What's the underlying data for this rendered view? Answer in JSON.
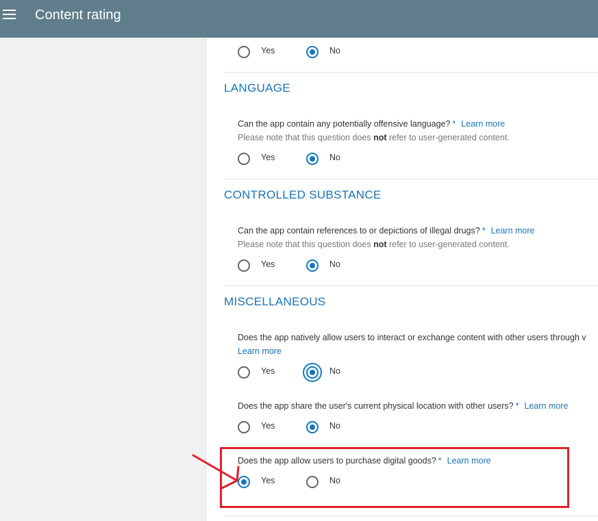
{
  "header": {
    "title": "Content rating"
  },
  "top_partial": {
    "yes_label": "Yes",
    "no_label": "No",
    "selected": "No"
  },
  "sections": [
    {
      "title": "LANGUAGE",
      "question": "Can the app contain any potentially offensive language?",
      "required": "*",
      "learn_more": "Learn more",
      "note_pre": "Please note that this question does ",
      "note_bold": "not",
      "note_post": " refer to user-generated content.",
      "yes_label": "Yes",
      "no_label": "No",
      "selected": "No"
    },
    {
      "title": "CONTROLLED SUBSTANCE",
      "question": "Can the app contain references to or depictions of illegal drugs?",
      "required": "*",
      "learn_more": "Learn more",
      "note_pre": "Please note that this question does ",
      "note_bold": "not",
      "note_post": " refer to user-generated content.",
      "yes_label": "Yes",
      "no_label": "No",
      "selected": "No"
    },
    {
      "title": "MISCELLANEOUS",
      "questions": [
        {
          "question": "Does the app natively allow users to interact or exchange content with other users through v",
          "learn_more": "Learn more",
          "yes_label": "Yes",
          "no_label": "No",
          "selected": "No"
        },
        {
          "question": "Does the app share the user's current physical location with other users?",
          "required": "*",
          "learn_more": "Learn more",
          "yes_label": "Yes",
          "no_label": "No",
          "selected": "No"
        },
        {
          "question": "Does the app allow users to purchase digital goods?",
          "required": "*",
          "learn_more": "Learn more",
          "yes_label": "Yes",
          "no_label": "No",
          "selected": "Yes"
        }
      ]
    }
  ],
  "annotation": {
    "box_color": "#e0202a"
  }
}
